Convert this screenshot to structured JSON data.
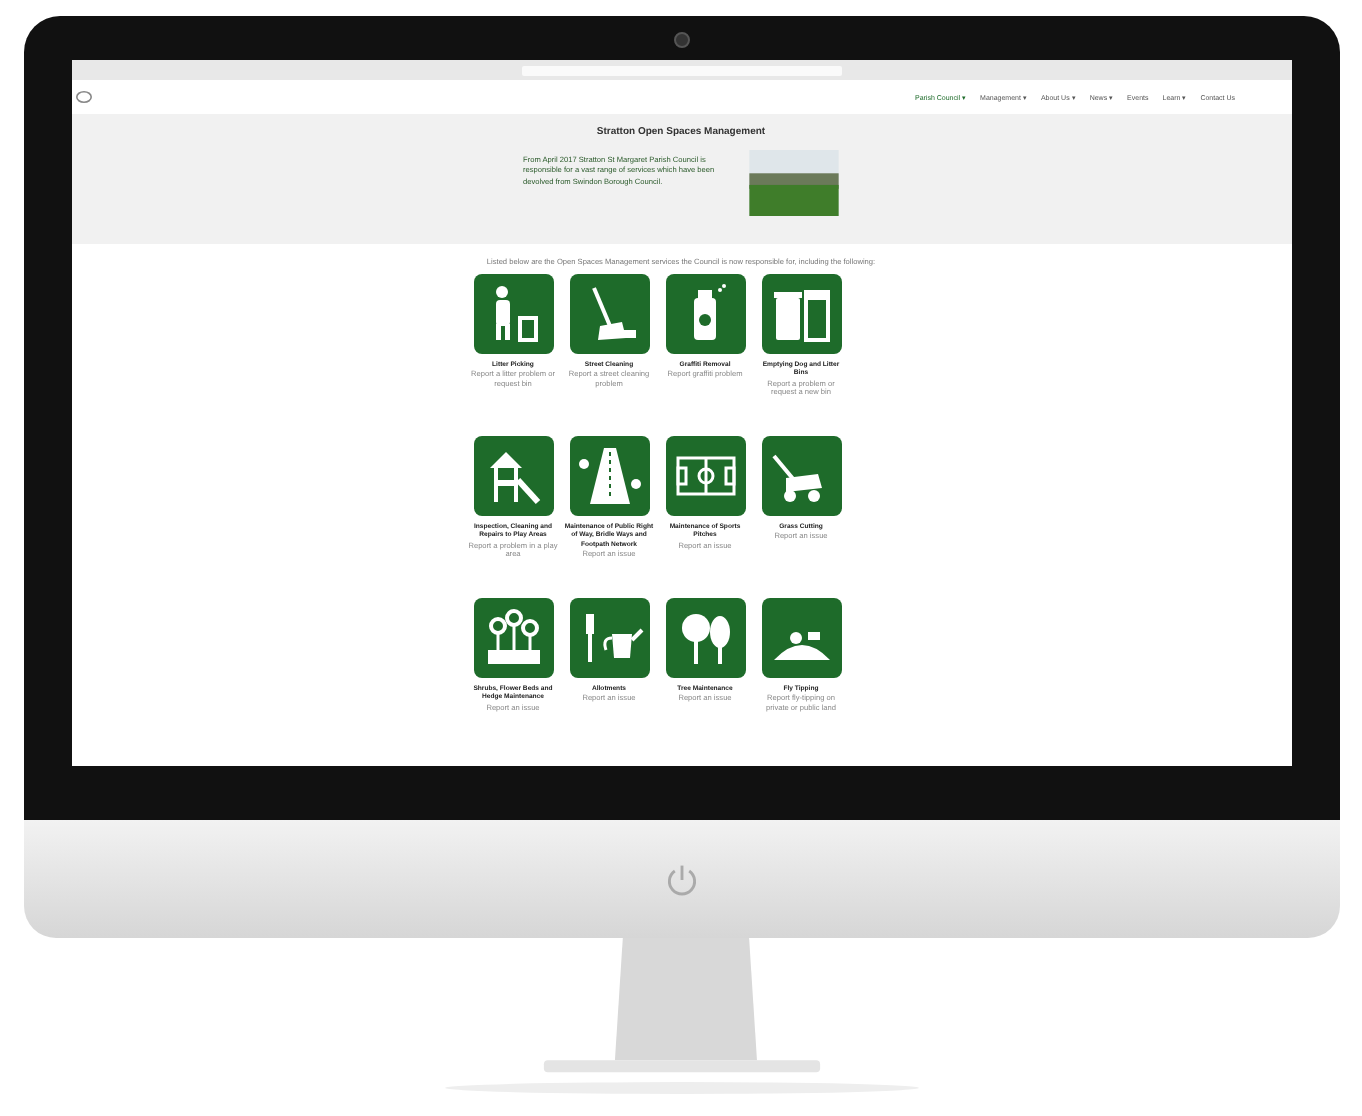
{
  "site": {
    "nav": [
      {
        "label": "Parish Council ▾",
        "selected": true
      },
      {
        "label": "Management ▾",
        "selected": false
      },
      {
        "label": "About Us ▾",
        "selected": false
      },
      {
        "label": "News ▾",
        "selected": false
      },
      {
        "label": "Events",
        "selected": false
      },
      {
        "label": "Learn ▾",
        "selected": false
      },
      {
        "label": "Contact Us",
        "selected": false
      }
    ],
    "title": "Stratton Open Spaces Management",
    "intro": "From April 2017 Stratton St Margaret Parish Council is responsible for a vast range of services which have been devolved from Swindon Borough Council.",
    "lead": "Listed below are the Open Spaces Management services the Council is now responsible for, including the following:",
    "services": [
      {
        "title": "Litter Picking",
        "subtitle": "Report a litter problem or request bin"
      },
      {
        "title": "Street Cleaning",
        "subtitle": "Report a street cleaning problem"
      },
      {
        "title": "Graffiti Removal",
        "subtitle": "Report graffiti problem"
      },
      {
        "title": "Emptying Dog and Litter Bins",
        "subtitle": "Report a problem or request a new bin"
      },
      {
        "title": "Inspection, Cleaning and Repairs to Play Areas",
        "subtitle": "Report a problem in a play area"
      },
      {
        "title": "Maintenance of Public Right of Way, Bridle Ways and Footpath Network",
        "subtitle": "Report an issue"
      },
      {
        "title": "Maintenance of Sports Pitches",
        "subtitle": "Report an issue"
      },
      {
        "title": "Grass Cutting",
        "subtitle": "Report an issue"
      },
      {
        "title": "Shrubs, Flower Beds and Hedge Maintenance",
        "subtitle": "Report an issue"
      },
      {
        "title": "Allotments",
        "subtitle": "Report an issue"
      },
      {
        "title": "Tree Maintenance",
        "subtitle": "Report an issue"
      },
      {
        "title": "Fly Tipping",
        "subtitle": "Report fly-tipping on private or public land"
      }
    ]
  }
}
